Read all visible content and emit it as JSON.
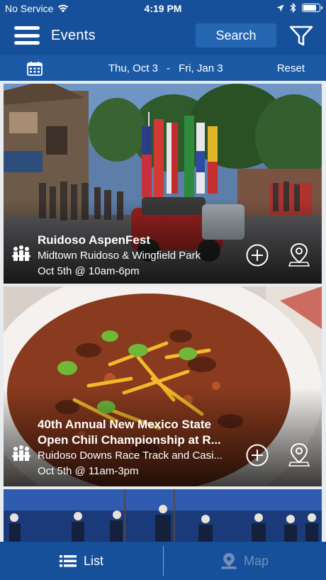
{
  "status_bar": {
    "carrier": "No Service",
    "time": "4:19 PM",
    "battery_level": 0.85
  },
  "nav": {
    "title": "Events",
    "search_label": "Search",
    "menu_icon": "hamburger-menu-icon",
    "filter_icon": "filter-funnel-icon"
  },
  "date_filter": {
    "start": "Thu, Oct 3",
    "separator": "-",
    "end": "Fri, Jan 3",
    "reset_label": "Reset",
    "icon": "calendar-icon"
  },
  "events": [
    {
      "title": "Ruidoso AspenFest",
      "venue": "Midtown Ruidoso & Wingfield Park",
      "time": "Oct 5th @ 10am-6pm",
      "category_icon": "crowd-icon"
    },
    {
      "title": "40th Annual New Mexico State",
      "title_line2": "Open Chili Championship at R...",
      "venue": "Ruidoso Downs Race Track and Casi...",
      "time": "Oct 5th @ 11am-3pm",
      "category_icon": "crowd-icon"
    },
    {
      "title": "",
      "venue": "",
      "time": "",
      "category_icon": ""
    }
  ],
  "tabs": {
    "list_label": "List",
    "map_label": "Map",
    "active": "List"
  },
  "colors": {
    "brand": "#17509a",
    "date_bar": "#1c5aa6",
    "search_button": "#2566b3",
    "inactive_tab": "#6f8fbb"
  }
}
